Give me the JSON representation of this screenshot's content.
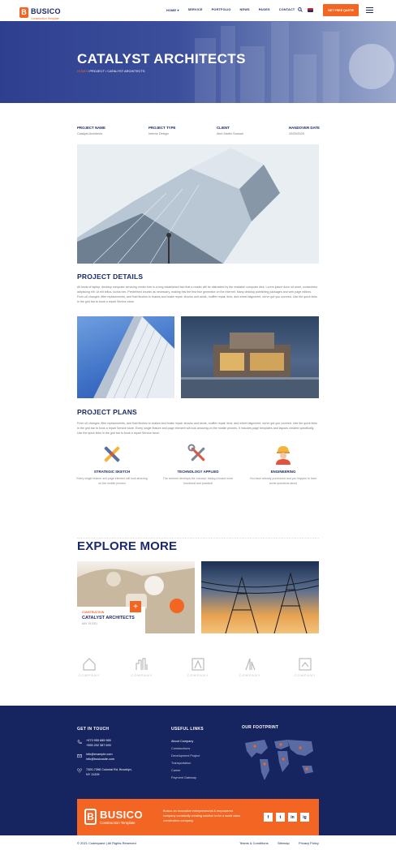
{
  "brand": {
    "name": "BUSICO",
    "tagline": "Construction Template",
    "accent": "#f26522",
    "navy": "#1b2a6b"
  },
  "nav": {
    "items": [
      "HOME ▾",
      "SERVICE",
      "PORTFOLIO",
      "NEWS",
      "PAGES",
      "CONTACT"
    ],
    "quote_label": "GET FREE QUOTE",
    "icons": [
      "search-icon",
      "flag-icon",
      "menu-icon"
    ]
  },
  "hero": {
    "title": "CATALYST ARCHITECTS",
    "crumb_home": "HOME",
    "crumb_sep": "/",
    "crumb_project": "PROJECT",
    "crumb_current": "CATALYST ARCHITECTS"
  },
  "meta": [
    {
      "label": "PROJECT NAME",
      "value": "Catalyst Architects"
    },
    {
      "label": "PROJECT TYPE",
      "value": "Interior Design"
    },
    {
      "label": "CLIENT",
      "value": "Alex Martin Samuel"
    },
    {
      "label": "HANDOVER DATE",
      "value": "20/09/2020"
    }
  ],
  "details": {
    "title": "PROJECT DETAILS",
    "text": "All kinds of laptop, desktop computer servicing center fore is a long established fact that a reader will be distracted by the readable computer disk. Lorem ipsum dolor sit amet, consectetur adipiscing elit. Ut elit tellus, luctus nec. Predefined chunks as necessary, making this the first true generator on the Internet. Many desktop publishing packages and web page editors. From oil changes, filter replacements, and fluid flushes to brakes and brake repair, shocks and struts, muffler repair, tires, and wheel alignment, we've got you covered. Use the quick links in the grid bar to book a repair Service store."
  },
  "plans": {
    "title": "PROJECT PLANS",
    "text": "From oil changes, filter replacements, and fluid flushes to brakes and brake repair, shocks and struts, muffler repair, tires, and wheel alignment, we've got you covered. Use the quick links in the grid bar to book a repair Service store. Every single feature and page element will look amazing on the mobile phones. It includes page templates and layouts created specifically. Use the quick links in the grid bar to book a repair Service store.",
    "features": [
      {
        "title": "STRATEGIC SKETCH",
        "desc": "Every single feature and page element will look amazing on the mobile phones"
      },
      {
        "title": "TECHNOLOGY APPLIED",
        "desc": "The scheme develops the concept, taking a board more functional and practical"
      },
      {
        "title": "ENGINEERING",
        "desc": "You have already purchased and you happen to have some questions about"
      }
    ]
  },
  "explore": {
    "title": "EXPLORE MORE",
    "card": {
      "category": "CONSTRUCTION",
      "name": "CATALYST ARCHITECTS",
      "date": "MAY 19 2021"
    },
    "plus": "+"
  },
  "clients": [
    "COMPANY",
    "COMPANY",
    "COMPANY",
    "COMPANY",
    "COMPANY"
  ],
  "footer": {
    "touch_title": "GET IN TOUCH",
    "phone1": "+573 955 685 985",
    "phone2": "+555 202 387 690",
    "email1": "info@example.com",
    "email2": "info@busicosite.com",
    "address1": "7300-7398 Colonial Rd, Brooklyn,",
    "address2": "NY 11209",
    "links_title": "USEFUL LINKS",
    "links": [
      "About Company",
      "Constructions",
      "Development Project",
      "Transportation",
      "Career",
      "Payment Gateway"
    ],
    "footprint_title": "OUR FOOTPRINT",
    "cta_text": "Busico an innovative entrepreneurial & empowered company constantly creating solution to for a world class construction company.",
    "social": [
      "f",
      "t",
      "in",
      "ig"
    ],
    "copyright": "© 2021 Codexpand  |  All Rights Reserved",
    "terms": "Teams & Conditions",
    "sitemap": "Sitemap",
    "privacy": "Privacy Policy"
  }
}
